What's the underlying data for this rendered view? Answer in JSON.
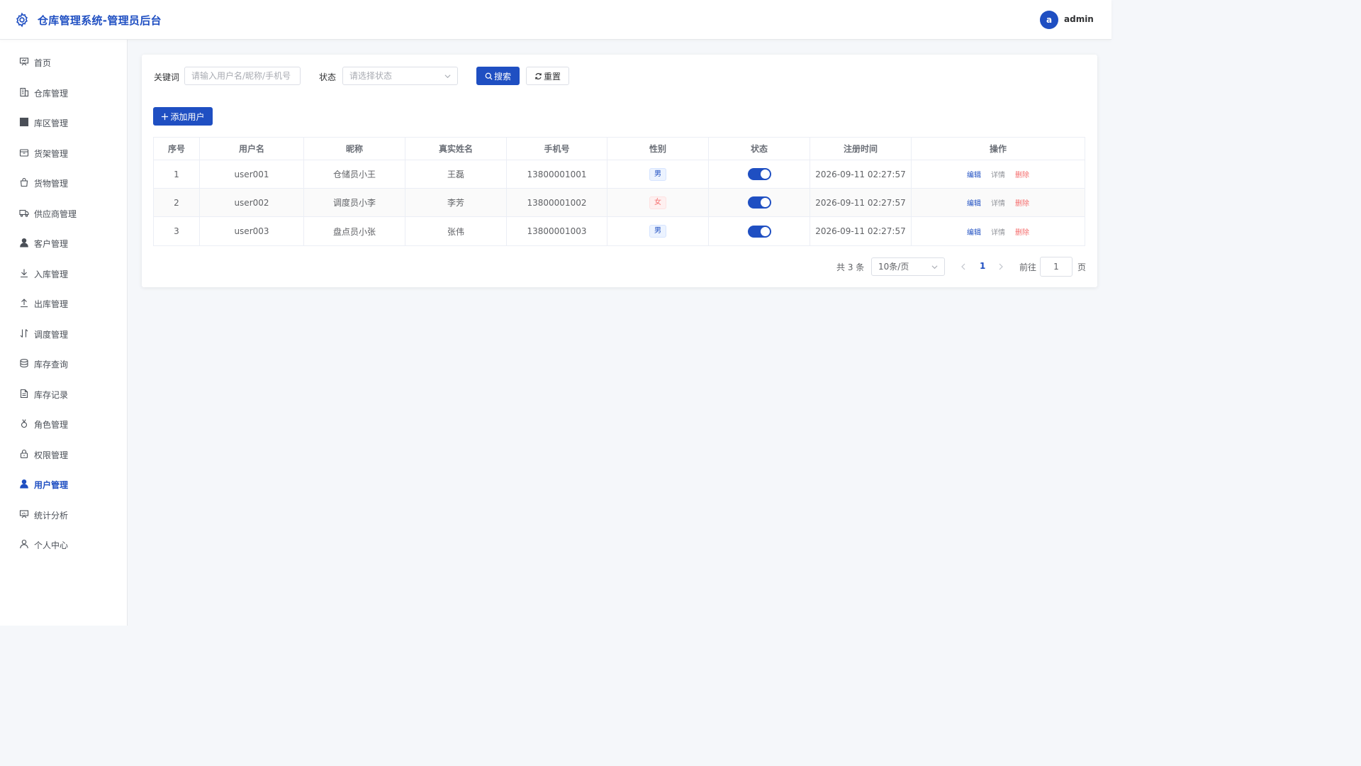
{
  "header": {
    "title": "仓库管理系统-管理员后台",
    "avatar_letter": "a",
    "username": "admin"
  },
  "sidebar": {
    "items": [
      {
        "label": "首页",
        "icon": "presentation-board-icon"
      },
      {
        "label": "仓库管理",
        "icon": "building-icon"
      },
      {
        "label": "库区管理",
        "icon": "grid-icon"
      },
      {
        "label": "货架管理",
        "icon": "shelf-box-icon"
      },
      {
        "label": "货物管理",
        "icon": "shopping-bag-icon"
      },
      {
        "label": "供应商管理",
        "icon": "truck-icon"
      },
      {
        "label": "客户管理",
        "icon": "user-filled-icon"
      },
      {
        "label": "入库管理",
        "icon": "download-icon"
      },
      {
        "label": "出库管理",
        "icon": "upload-icon"
      },
      {
        "label": "调度管理",
        "icon": "sort-arrows-icon"
      },
      {
        "label": "库存查询",
        "icon": "coins-icon"
      },
      {
        "label": "库存记录",
        "icon": "document-icon"
      },
      {
        "label": "角色管理",
        "icon": "medal-icon"
      },
      {
        "label": "权限管理",
        "icon": "lock-icon"
      },
      {
        "label": "用户管理",
        "icon": "user-filled-icon"
      },
      {
        "label": "统计分析",
        "icon": "data-board-icon"
      },
      {
        "label": "个人中心",
        "icon": "user-outline-icon"
      }
    ],
    "active_index": 14
  },
  "filters": {
    "keyword_label": "关键词",
    "keyword_placeholder": "请输入用户名/昵称/手机号",
    "status_label": "状态",
    "status_placeholder": "请选择状态",
    "search_label": "搜索",
    "reset_label": "重置"
  },
  "add_button_label": "添加用户",
  "table": {
    "columns": [
      "序号",
      "用户名",
      "昵称",
      "真实姓名",
      "手机号",
      "性别",
      "状态",
      "注册时间",
      "操作"
    ],
    "rows": [
      {
        "index": "1",
        "username": "user001",
        "nickname": "仓储员小王",
        "real_name": "王磊",
        "phone": "13800001001",
        "gender": "男",
        "enabled": true,
        "registered": "2026-09-11 02:27:57"
      },
      {
        "index": "2",
        "username": "user002",
        "nickname": "调度员小李",
        "real_name": "李芳",
        "phone": "13800001002",
        "gender": "女",
        "enabled": true,
        "registered": "2026-09-11 02:27:57"
      },
      {
        "index": "3",
        "username": "user003",
        "nickname": "盘点员小张",
        "real_name": "张伟",
        "phone": "13800001003",
        "gender": "男",
        "enabled": true,
        "registered": "2026-09-11 02:27:57"
      }
    ],
    "actions": {
      "edit": "编辑",
      "detail": "详情",
      "delete": "删除"
    }
  },
  "pagination": {
    "total_text": "共 3 条",
    "page_size": "10条/页",
    "current_page": "1",
    "goto_label": "前往",
    "goto_value": "1",
    "page_unit": "页"
  },
  "colors": {
    "primary": "#1f4fc2",
    "danger": "#f56c6c",
    "background": "#f5f7fa"
  }
}
